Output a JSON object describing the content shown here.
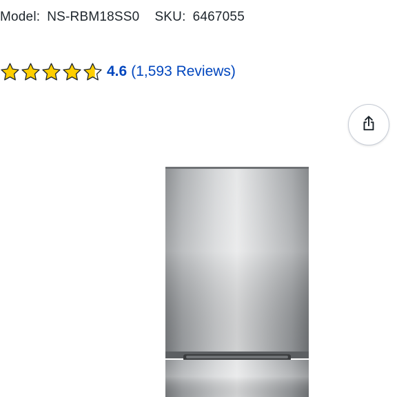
{
  "product": {
    "model_label": "Model:",
    "model_value": "NS-RBM18SS0",
    "sku_label": "SKU:",
    "sku_value": "6467055"
  },
  "rating": {
    "stars": 4.6,
    "score": "4.6",
    "reviews": "(1,593 Reviews)",
    "star_color": "#ffce00",
    "star_outline": "#1d252c",
    "link_color": "#0046be"
  },
  "share": {
    "icon": "share-icon"
  },
  "image": {
    "subject": "stainless-steel-refrigerator"
  }
}
